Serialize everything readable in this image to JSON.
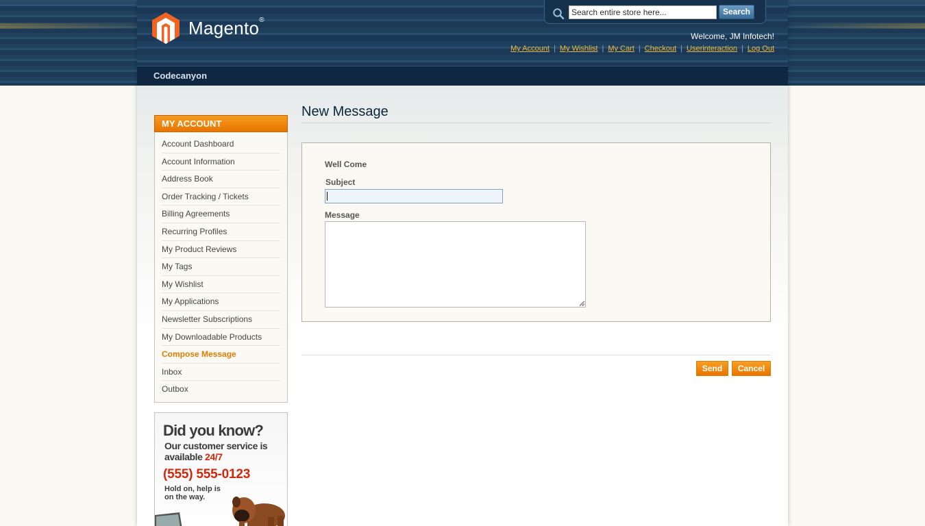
{
  "header": {
    "logo_text": "Magento",
    "logo_reg": "®",
    "search": {
      "placeholder": "Search entire store here...",
      "value": "Search entire store here...",
      "button_label": "Search"
    },
    "welcome": "Welcome, JM Infotech!",
    "links": [
      {
        "label": "My Account"
      },
      {
        "label": "My Wishlist"
      },
      {
        "label": "My Cart"
      },
      {
        "label": "Checkout"
      },
      {
        "label": "Userinteraction"
      },
      {
        "label": "Log Out"
      }
    ],
    "separator": "|"
  },
  "nav": {
    "store_name": "Codecanyon"
  },
  "sidebar": {
    "title": "MY ACCOUNT",
    "items": [
      {
        "label": "Account Dashboard"
      },
      {
        "label": "Account Information"
      },
      {
        "label": "Address Book"
      },
      {
        "label": "Order Tracking / Tickets"
      },
      {
        "label": "Billing Agreements"
      },
      {
        "label": "Recurring Profiles"
      },
      {
        "label": "My Product Reviews"
      },
      {
        "label": "My Tags"
      },
      {
        "label": "My Wishlist"
      },
      {
        "label": "My Applications"
      },
      {
        "label": "Newsletter Subscriptions"
      },
      {
        "label": "My Downloadable Products"
      },
      {
        "label": "Compose Message",
        "active": true
      },
      {
        "label": "Inbox"
      },
      {
        "label": "Outbox"
      }
    ]
  },
  "banner": {
    "title": "Did you know?",
    "line1": "Our customer service is",
    "line2_prefix": "available ",
    "line2_highlight": "24/7",
    "phone": "(555) 555-0123",
    "small": "Hold on, help is on the way."
  },
  "form": {
    "page_title": "New Message",
    "greeting": "Well Come",
    "subject_label": "Subject",
    "subject_value": "",
    "message_label": "Message",
    "message_value": "",
    "send_label": "Send",
    "cancel_label": "Cancel"
  },
  "colors": {
    "accent_orange": "#f18200",
    "header_blue": "#1d3b5a",
    "link_gold": "#ebbb40",
    "phone_red": "#d4260a"
  }
}
